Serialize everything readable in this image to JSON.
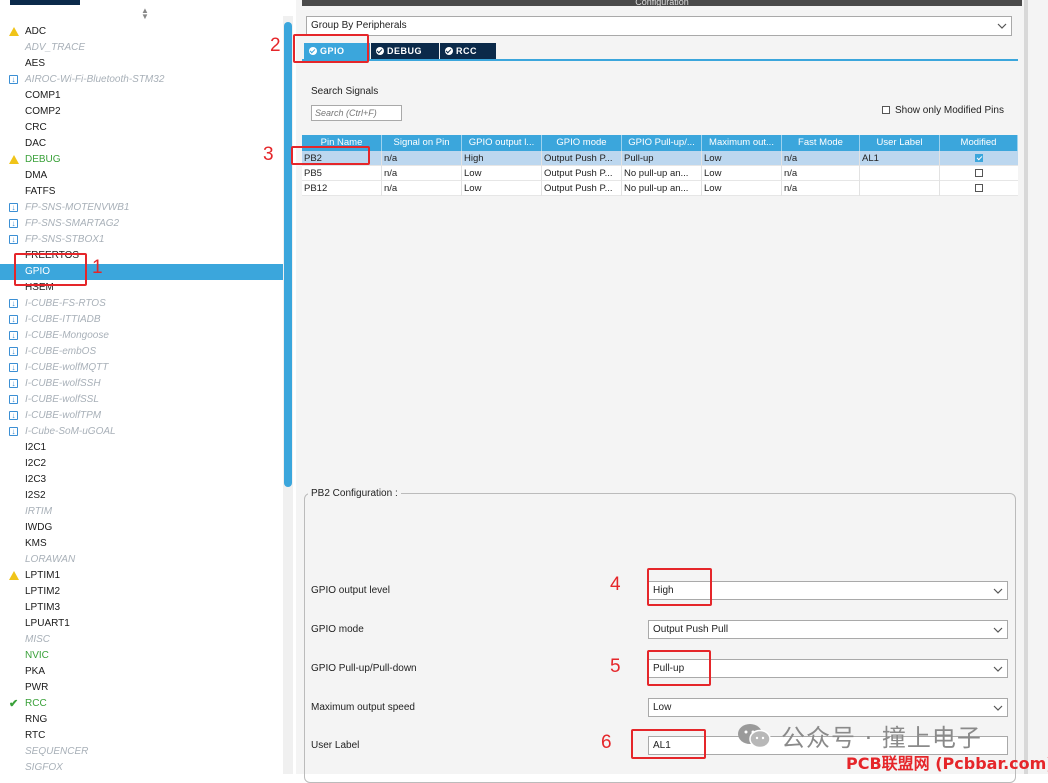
{
  "sidebar": {
    "items": [
      {
        "label": "ADC",
        "state": "warn"
      },
      {
        "label": "ADV_TRACE",
        "state": "disabled"
      },
      {
        "label": "AES",
        "state": "normal"
      },
      {
        "label": "AIROC-Wi-Fi-Bluetooth-STM32",
        "state": "pack"
      },
      {
        "label": "COMP1",
        "state": "normal"
      },
      {
        "label": "COMP2",
        "state": "normal"
      },
      {
        "label": "CRC",
        "state": "normal"
      },
      {
        "label": "DAC",
        "state": "normal"
      },
      {
        "label": "DEBUG",
        "state": "warn-green"
      },
      {
        "label": "DMA",
        "state": "normal"
      },
      {
        "label": "FATFS",
        "state": "normal"
      },
      {
        "label": "FP-SNS-MOTENVWB1",
        "state": "pack"
      },
      {
        "label": "FP-SNS-SMARTAG2",
        "state": "pack"
      },
      {
        "label": "FP-SNS-STBOX1",
        "state": "pack"
      },
      {
        "label": "FREERTOS",
        "state": "normal"
      },
      {
        "label": "GPIO",
        "state": "selected"
      },
      {
        "label": "HSEM",
        "state": "normal"
      },
      {
        "label": "I-CUBE-FS-RTOS",
        "state": "pack"
      },
      {
        "label": "I-CUBE-ITTIADB",
        "state": "pack"
      },
      {
        "label": "I-CUBE-Mongoose",
        "state": "pack"
      },
      {
        "label": "I-CUBE-embOS",
        "state": "pack"
      },
      {
        "label": "I-CUBE-wolfMQTT",
        "state": "pack"
      },
      {
        "label": "I-CUBE-wolfSSH",
        "state": "pack"
      },
      {
        "label": "I-CUBE-wolfSSL",
        "state": "pack"
      },
      {
        "label": "I-CUBE-wolfTPM",
        "state": "pack"
      },
      {
        "label": "I-Cube-SoM-uGOAL",
        "state": "pack"
      },
      {
        "label": "I2C1",
        "state": "normal"
      },
      {
        "label": "I2C2",
        "state": "normal"
      },
      {
        "label": "I2C3",
        "state": "normal"
      },
      {
        "label": "I2S2",
        "state": "normal"
      },
      {
        "label": "IRTIM",
        "state": "disabled"
      },
      {
        "label": "IWDG",
        "state": "normal"
      },
      {
        "label": "KMS",
        "state": "normal"
      },
      {
        "label": "LORAWAN",
        "state": "disabled"
      },
      {
        "label": "LPTIM1",
        "state": "warn"
      },
      {
        "label": "LPTIM2",
        "state": "normal"
      },
      {
        "label": "LPTIM3",
        "state": "normal"
      },
      {
        "label": "LPUART1",
        "state": "normal"
      },
      {
        "label": "MISC",
        "state": "disabled"
      },
      {
        "label": "NVIC",
        "state": "green"
      },
      {
        "label": "PKA",
        "state": "normal"
      },
      {
        "label": "PWR",
        "state": "normal"
      },
      {
        "label": "RCC",
        "state": "check-green"
      },
      {
        "label": "RNG",
        "state": "normal"
      },
      {
        "label": "RTC",
        "state": "normal"
      },
      {
        "label": "SEQUENCER",
        "state": "disabled"
      },
      {
        "label": "SIGFOX",
        "state": "disabled"
      }
    ]
  },
  "config": {
    "header_title": "Configuration",
    "group_by": "Group By Peripherals",
    "tabs": [
      {
        "label": "GPIO",
        "active": true
      },
      {
        "label": "DEBUG",
        "active": false
      },
      {
        "label": "RCC",
        "active": false
      }
    ],
    "search_label": "Search Signals",
    "search_placeholder": "Search (Ctrl+F)",
    "modified_only_label": "Show only Modified Pins"
  },
  "table": {
    "headers": [
      "Pin Name",
      "Signal on Pin",
      "GPIO output l...",
      "GPIO mode",
      "GPIO Pull-up/...",
      "Maximum out...",
      "Fast Mode",
      "User Label",
      "Modified"
    ],
    "rows": [
      {
        "cells": [
          "PB2",
          "n/a",
          "High",
          "Output Push P...",
          "Pull-up",
          "Low",
          "n/a",
          "AL1"
        ],
        "modified": true,
        "selected": true
      },
      {
        "cells": [
          "PB5",
          "n/a",
          "Low",
          "Output Push P...",
          "No pull-up an...",
          "Low",
          "n/a",
          ""
        ],
        "modified": false,
        "selected": false
      },
      {
        "cells": [
          "PB12",
          "n/a",
          "Low",
          "Output Push P...",
          "No pull-up an...",
          "Low",
          "n/a",
          ""
        ],
        "modified": false,
        "selected": false
      }
    ]
  },
  "pb2": {
    "title": "PB2 Configuration :",
    "fields": [
      {
        "label": "GPIO output level",
        "value": "High"
      },
      {
        "label": "GPIO mode",
        "value": "Output Push Pull"
      },
      {
        "label": "GPIO Pull-up/Pull-down",
        "value": "Pull-up"
      },
      {
        "label": "Maximum output speed",
        "value": "Low"
      }
    ],
    "user_label": {
      "label": "User Label",
      "value": "AL1"
    }
  },
  "annotations": [
    "1",
    "2",
    "3",
    "4",
    "5",
    "6"
  ],
  "watermark": {
    "text": "公众号 · 撞上电子",
    "site": "PCB联盟网 (Pcbbar.com)"
  },
  "colors": {
    "accent": "#3ba6dc",
    "tab_dark": "#0b2a4a",
    "annotation_red": "#e5262a",
    "warn": "#f0c419",
    "ok_green": "#3aa13a"
  }
}
